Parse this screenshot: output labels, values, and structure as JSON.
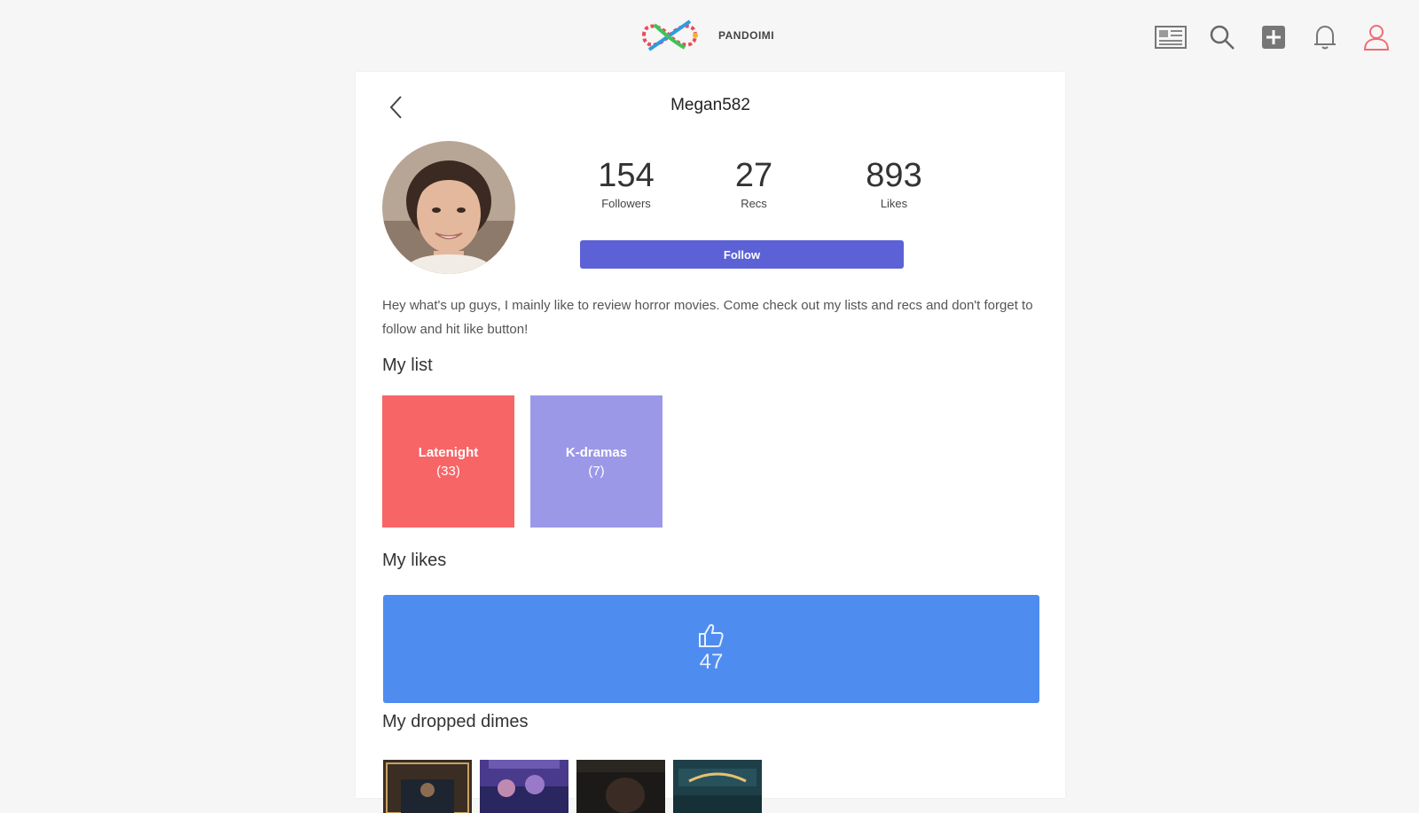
{
  "brand": {
    "name": "PANDOIMI",
    "logo": "infinity-logo"
  },
  "topbar": {
    "icons": [
      "news-icon",
      "search-icon",
      "add-icon",
      "bell-icon",
      "user-icon"
    ],
    "accent_user": "#f06d72"
  },
  "profile": {
    "username": "Megan582",
    "stats": {
      "followers": {
        "value": "154",
        "label": "Followers"
      },
      "recs": {
        "value": "27",
        "label": "Recs"
      },
      "likes": {
        "value": "893",
        "label": "Likes"
      }
    },
    "follow_label": "Follow",
    "bio": "Hey what's up guys, I mainly like to review horror movies. Come check out my lists and recs and don't forget to follow and hit like button!"
  },
  "my_list": {
    "title": "My list",
    "items": [
      {
        "name": "Latenight",
        "count": "(33)",
        "color": "#f76567"
      },
      {
        "name": "K-dramas",
        "count": "(7)",
        "color": "#9c98e8"
      }
    ]
  },
  "my_likes": {
    "title": "My likes",
    "count": "47",
    "color": "#4e8cf0"
  },
  "my_dimes": {
    "title": "My dropped dimes",
    "count": 4
  },
  "colors": {
    "follow": "#5c61d6",
    "background": "#f6f6f6",
    "card": "#ffffff"
  }
}
